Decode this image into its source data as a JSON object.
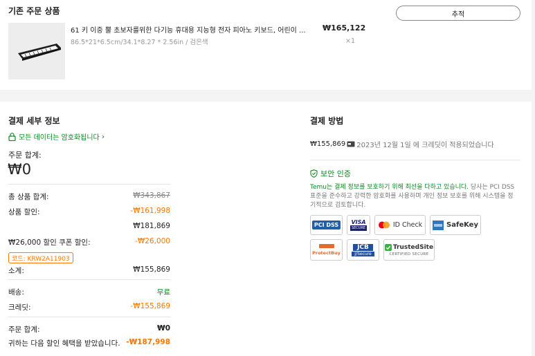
{
  "order": {
    "title": "기존 주문 상품",
    "track_label": "추적",
    "product_name": "61 키 이중 뿔 초보자를위한 다기능 휴대용 지능형 전자 피아노 키보드, 어린이 ...",
    "product_price": "₩165,122",
    "product_variant": "86.5*21*6.5cm/34.1*8.27 * 2.56in / 검은색",
    "product_qty": "×1"
  },
  "details": {
    "title": "결제 세부 정보",
    "encrypted_note": "모든 데이터는 암호화됩니다",
    "order_total_label": "주문 합계:",
    "order_total_big": "₩0",
    "rows": {
      "item_total_label": "총 상품 합계:",
      "item_total_value": "₩343,867",
      "item_discount_label": "상품 할인:",
      "item_discount_value": "-₩161,998",
      "subtotal_after_discount": "₩181,869",
      "coupon_label": "₩26,000 할인 쿠폰 할인:",
      "coupon_value": "-₩26,000",
      "coupon_code": "코드: KRW2A11903",
      "subtotal_label": "소계:",
      "subtotal_value": "₩155,869",
      "shipping_label": "배송:",
      "shipping_value": "무료",
      "credit_label": "크레딧:",
      "credit_value": "-₩155,869",
      "final_total_label": "주문 합계:",
      "final_total_value": "₩0",
      "savings_label": "귀하는 다음 할인 혜택을 받았습니다.",
      "savings_value": "-₩187,998"
    }
  },
  "payment": {
    "title": "결제 방법",
    "amount": "₩155,869",
    "credit_note": "2023년 12월 1일 에 크레딧이 적용되었습니다",
    "security_title": "보안 인증",
    "security_text_green": "Temu는 결제 정보를 보호하기 위해 최선을 다하고 있습니다.",
    "security_text_gray": " 당사는 PCI DSS 표준을 준수하고 강력한 암호화를 사용하며 개인 정보 보호를 위해 시스템을 정기적으로 검토합니다.",
    "badges": {
      "pci": "PCI DSS",
      "visa": "VISA",
      "visa_sub": "SECURE",
      "idcheck": "ID Check",
      "safekey": "SafeKey",
      "protectbuy": "ProtectBuy",
      "jcb": "JCB",
      "jcb_sub": "J/Secure",
      "trustedsite": "TrustedSite",
      "trustedsite_sub": "CERTIFIED SECURE"
    }
  },
  "colors": {
    "green": "#0a8a1f",
    "orange": "#fb7701"
  }
}
